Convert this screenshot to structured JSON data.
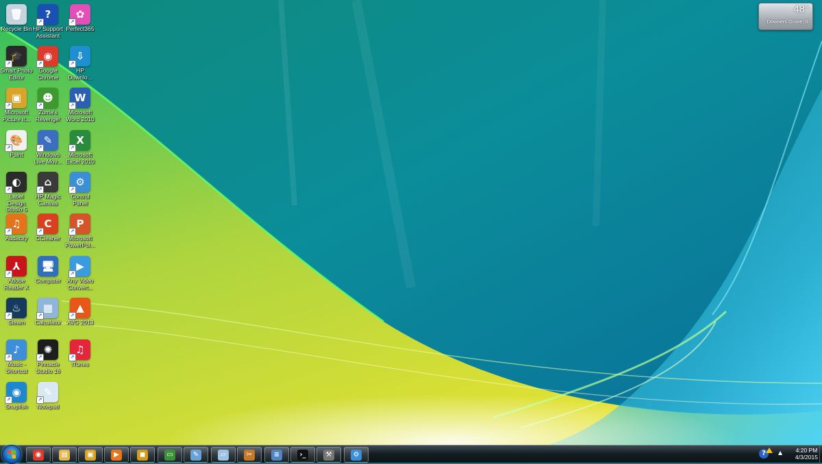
{
  "desktop": {
    "icons": [
      {
        "label": "Recycle Bin",
        "icon": "recycle-bin-icon",
        "color": "#c7d3df",
        "glyph": "🗑",
        "shortcut": false
      },
      {
        "label": "HP Support\nAssistant",
        "icon": "hp-support-assistant-icon",
        "color": "#1a4fb4",
        "glyph": "?",
        "shortcut": true
      },
      {
        "label": "Perfect365",
        "icon": "perfect365-icon",
        "color": "#e24fb8",
        "glyph": "✿",
        "shortcut": true
      },
      {
        "label": "Smart Photo\nEditor",
        "icon": "smart-photo-editor-icon",
        "color": "#2a2a2a",
        "glyph": "🎓",
        "shortcut": true
      },
      {
        "label": "Google\nChrome",
        "icon": "google-chrome-icon",
        "color": "#db3a2c",
        "glyph": "◉",
        "shortcut": true
      },
      {
        "label": "HP\nDownlo...",
        "icon": "hp-download-icon",
        "color": "#1e8fd1",
        "glyph": "⇩",
        "shortcut": true
      },
      {
        "label": "Microsoft\nPicture It...",
        "icon": "picture-it-icon",
        "color": "#d8a52a",
        "glyph": "▣",
        "shortcut": true
      },
      {
        "label": "Zuma's\nRevenge!",
        "icon": "zumas-revenge-icon",
        "color": "#3d9a2e",
        "glyph": "☻",
        "shortcut": true
      },
      {
        "label": "Microsoft\nWord 2010",
        "icon": "word-icon",
        "color": "#2b5fb4",
        "glyph": "W",
        "shortcut": true
      },
      {
        "label": "Paint",
        "icon": "paint-icon",
        "color": "#f0f0f0",
        "glyph": "🎨",
        "shortcut": true
      },
      {
        "label": "Windows\nLive Mov...",
        "icon": "windows-live-movie-icon",
        "color": "#3a6fc0",
        "glyph": "✎",
        "shortcut": true
      },
      {
        "label": "Microsoft\nExcel 2010",
        "icon": "excel-icon",
        "color": "#2a8a3e",
        "glyph": "X",
        "shortcut": true
      },
      {
        "label": "Label Design\nStudio 5",
        "icon": "label-design-studio-icon",
        "color": "#2b2b2b",
        "glyph": "◐",
        "shortcut": true
      },
      {
        "label": "HP Magic\nCanvas",
        "icon": "hp-magic-canvas-icon",
        "color": "#3a3a3a",
        "glyph": "⌂",
        "shortcut": true
      },
      {
        "label": "Control\nPanel",
        "icon": "control-panel-icon",
        "color": "#3a8fd6",
        "glyph": "⚙",
        "shortcut": true
      },
      {
        "label": "Audacity",
        "icon": "audacity-icon",
        "color": "#e3741c",
        "glyph": "♫",
        "shortcut": true
      },
      {
        "label": "CCleaner",
        "icon": "ccleaner-icon",
        "color": "#d7411d",
        "glyph": "C",
        "shortcut": true
      },
      {
        "label": "Microsoft\nPowerPoi...",
        "icon": "powerpoint-icon",
        "color": "#d4552a",
        "glyph": "P",
        "shortcut": true
      },
      {
        "label": "Adobe\nReader X",
        "icon": "adobe-reader-icon",
        "color": "#c8141b",
        "glyph": "⅄",
        "shortcut": true
      },
      {
        "label": "Computer",
        "icon": "computer-icon",
        "color": "#2f6fbf",
        "glyph": "🖥",
        "shortcut": false
      },
      {
        "label": "Any Video\nConvert...",
        "icon": "any-video-converter-icon",
        "color": "#3b9be0",
        "glyph": "▶",
        "shortcut": true
      },
      {
        "label": "Steam",
        "icon": "steam-icon",
        "color": "#163a5e",
        "glyph": "♨",
        "shortcut": true
      },
      {
        "label": "Calculator",
        "icon": "calculator-icon",
        "color": "#8fb6da",
        "glyph": "▦",
        "shortcut": true
      },
      {
        "label": "AVG 2013",
        "icon": "avg-icon",
        "color": "#e8561a",
        "glyph": "▲",
        "shortcut": true
      },
      {
        "label": "Music -\nShortcut",
        "icon": "music-shortcut-icon",
        "color": "#3c8fd8",
        "glyph": "♪",
        "shortcut": true
      },
      {
        "label": "Pinnacle\nStudio 16",
        "icon": "pinnacle-studio-icon",
        "color": "#1d1d1d",
        "glyph": "✺",
        "shortcut": true
      },
      {
        "label": "iTunes",
        "icon": "itunes-icon",
        "color": "#e3263b",
        "glyph": "♫",
        "shortcut": true
      },
      {
        "label": "Snapfish",
        "icon": "snapfish-icon",
        "color": "#1f87cf",
        "glyph": "◉",
        "shortcut": true
      },
      {
        "label": "Notepad",
        "icon": "notepad-icon",
        "color": "#d9e9f3",
        "glyph": "✎",
        "shortcut": true
      }
    ]
  },
  "weather": {
    "temperature": "48°",
    "location": "Downers Grove, IL"
  },
  "taskbar": {
    "buttons": [
      {
        "name": "taskbar-chrome-button",
        "icon": "chrome-icon",
        "color": "#db3a2c",
        "glyph": "◉"
      },
      {
        "name": "taskbar-explorer-button",
        "icon": "folder-icon",
        "color": "#e3b54a",
        "glyph": "▤"
      },
      {
        "name": "taskbar-picture-it-button",
        "icon": "picture-it-icon",
        "color": "#d8a52a",
        "glyph": "▣"
      },
      {
        "name": "taskbar-media-player-button",
        "icon": "media-player-icon",
        "color": "#e8761c",
        "glyph": "▶"
      },
      {
        "name": "taskbar-app-button",
        "icon": "lock-icon",
        "color": "#d79b1a",
        "glyph": "◼"
      },
      {
        "name": "taskbar-remote-button",
        "icon": "monitor-icon",
        "color": "#3e8f3a",
        "glyph": "▭"
      },
      {
        "name": "taskbar-paint-button",
        "icon": "paint-icon",
        "color": "#6aa2d8",
        "glyph": "✎"
      },
      {
        "name": "taskbar-notepad-button",
        "icon": "notepad-icon",
        "color": "#9cc3e4",
        "glyph": "▱"
      },
      {
        "name": "taskbar-movie-maker-button",
        "icon": "movie-maker-icon",
        "color": "#c47a2a",
        "glyph": "✂"
      },
      {
        "name": "taskbar-document-button",
        "icon": "document-icon",
        "color": "#4f86c6",
        "glyph": "≡"
      },
      {
        "name": "taskbar-cmd-button",
        "icon": "command-prompt-icon",
        "color": "#111111",
        "glyph": "›_"
      },
      {
        "name": "taskbar-tools-button",
        "icon": "tools-icon",
        "color": "#777777",
        "glyph": "⚒"
      },
      {
        "name": "taskbar-control-panel-button",
        "icon": "control-panel-icon",
        "color": "#3a8fd6",
        "glyph": "⚙"
      }
    ],
    "clock_time": "4:20 PM",
    "clock_date": "4/3/2015"
  }
}
